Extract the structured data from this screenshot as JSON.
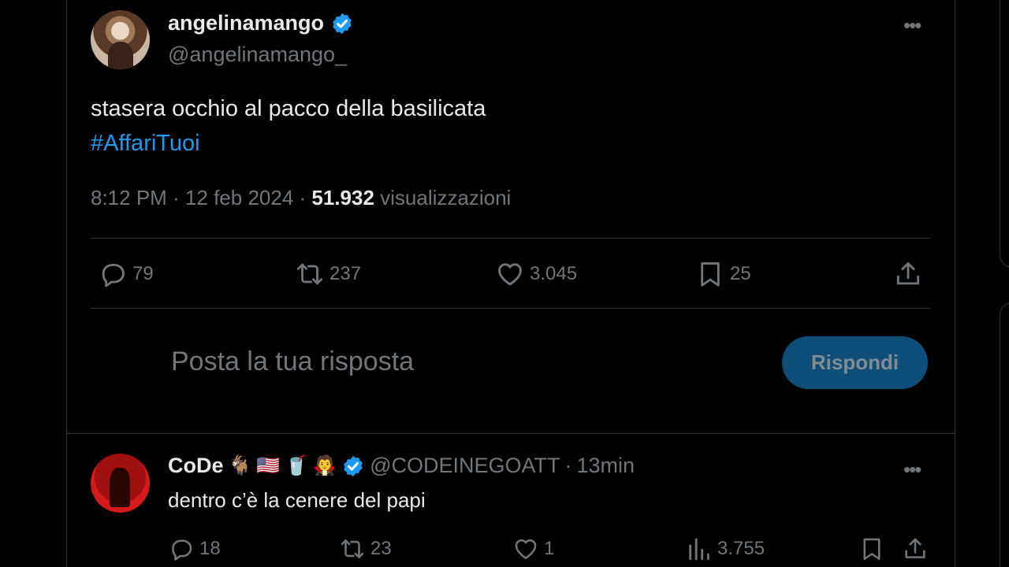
{
  "tweet": {
    "display_name": "angelinamango",
    "handle": "@angelinamango_",
    "text": "stasera occhio al pacco della basilicata",
    "hashtag": "#AffariTuoi",
    "time": "8:12 PM · 12 feb 2024 · ",
    "views_count": "51.932",
    "views_label": " visualizzazioni",
    "actions": {
      "replies": "79",
      "reposts": "237",
      "likes": "3.045",
      "bookmarks": "25"
    }
  },
  "reply_composer": {
    "placeholder": "Posta la tua risposta",
    "button_label": "Rispondi"
  },
  "reply": {
    "display_name": "CoDe",
    "emojis": [
      "🐐",
      "🇺🇸",
      "🥤",
      "🧛"
    ],
    "handle": "@CODEINEGOATT",
    "dot": "·",
    "time": "13min",
    "text": "dentro c’è la cenere del papi",
    "actions": {
      "replies": "18",
      "reposts": "23",
      "likes": "1",
      "views": "3.755"
    }
  },
  "colors": {
    "background": "#000000",
    "text": "#e7e9ea",
    "secondary": "#71767b",
    "link": "#1d9bf0",
    "verified": "#1d9bf0",
    "reply_button_bg": "#0f4e78"
  },
  "icons": {
    "verified": "verified-badge-icon",
    "more": "more-options-icon",
    "reply": "reply-bubble-icon",
    "repost": "repost-icon",
    "like": "heart-icon",
    "bookmark": "bookmark-icon",
    "share": "share-icon",
    "views": "views-chart-icon"
  }
}
